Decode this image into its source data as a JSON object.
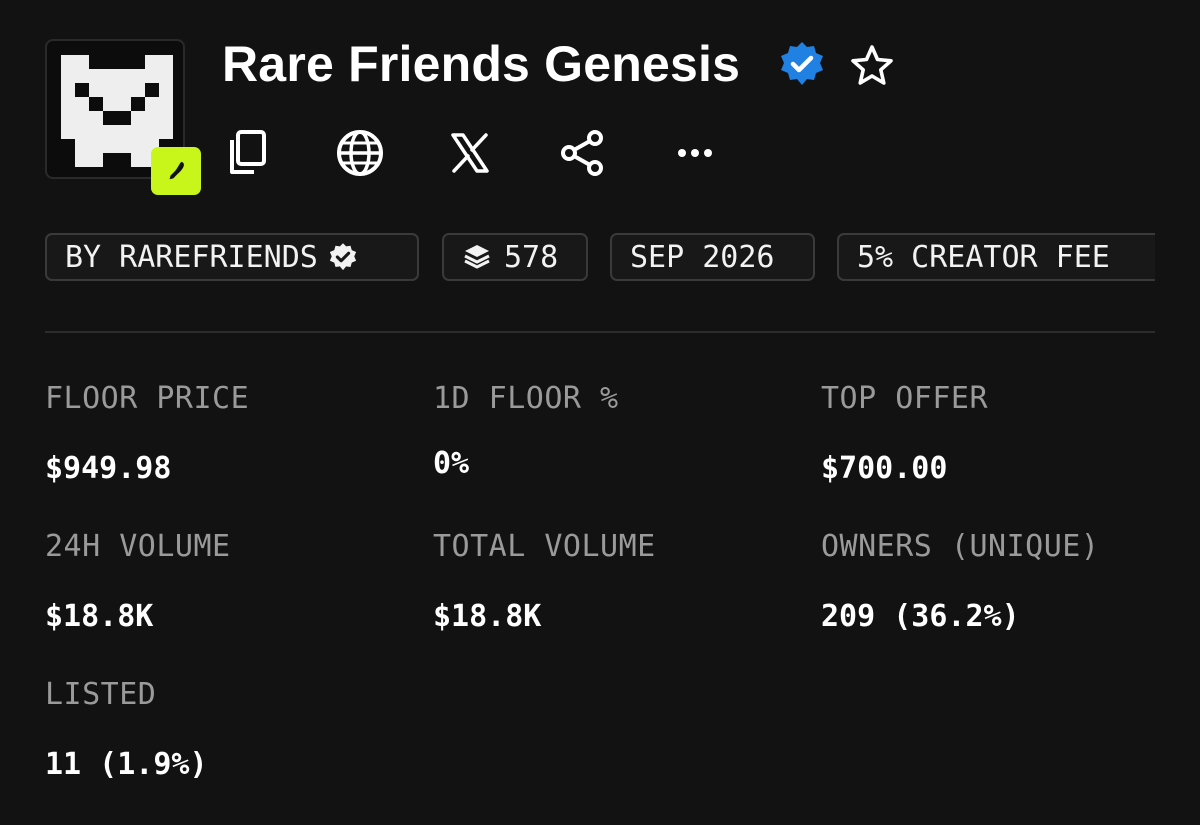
{
  "collection": {
    "name": "Rare Friends Genesis",
    "verified": true,
    "favorited": false
  },
  "actions": [
    {
      "name": "copy-icon"
    },
    {
      "name": "globe-icon"
    },
    {
      "name": "x-icon"
    },
    {
      "name": "share-icon"
    },
    {
      "name": "more-icon"
    }
  ],
  "chips": {
    "creator": "BY RAREFRIENDS",
    "items": "578",
    "date": "SEP 2026",
    "fee": "5% CREATOR FEE"
  },
  "stats": {
    "floor_price_label": "FLOOR PRICE",
    "floor_price_value": "$949.98",
    "floor_change_label": "1D FLOOR %",
    "floor_change_value": "0%",
    "top_offer_label": "TOP OFFER",
    "top_offer_value": "$700.00",
    "volume_24h_label": "24H VOLUME",
    "volume_24h_value": "$18.8K",
    "total_volume_label": "TOTAL VOLUME",
    "total_volume_value": "$18.8K",
    "owners_label": "OWNERS (UNIQUE)",
    "owners_value": "209 (36.2%)",
    "listed_label": "LISTED",
    "listed_value": "11 (1.9%)"
  },
  "colors": {
    "background": "#121212",
    "accent_badge": "#c8f51a",
    "verified_blue": "#2081e2",
    "label_gray": "#9a9a9a"
  }
}
